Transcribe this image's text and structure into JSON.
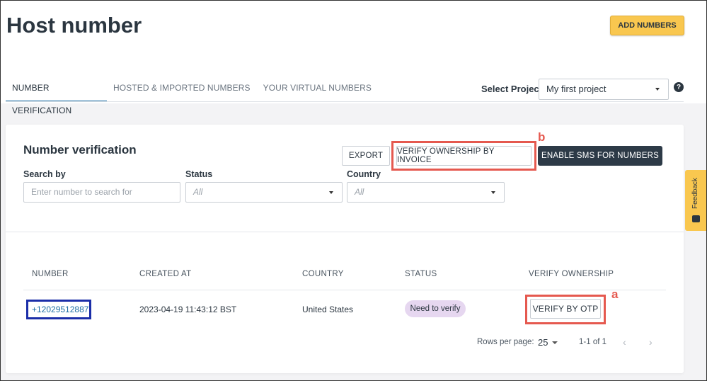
{
  "page": {
    "title": "Host number",
    "add_numbers_label": "ADD NUMBERS"
  },
  "tabs": [
    {
      "label": "NUMBER VERIFICATION",
      "active": true
    },
    {
      "label": "HOSTED & IMPORTED NUMBERS",
      "active": false
    },
    {
      "label": "YOUR VIRTUAL NUMBERS",
      "active": false
    }
  ],
  "project": {
    "label": "Select Project",
    "value": "My first project"
  },
  "card": {
    "title": "Number verification",
    "export_label": "EXPORT",
    "verify_invoice_label": "VERIFY OWNERSHIP BY INVOICE",
    "enable_sms_label": "ENABLE SMS FOR NUMBERS"
  },
  "filters": {
    "search_label": "Search by",
    "search_placeholder": "Enter number to search for",
    "status_label": "Status",
    "status_value": "All",
    "country_label": "Country",
    "country_value": "All"
  },
  "table": {
    "headers": [
      "NUMBER",
      "CREATED AT",
      "COUNTRY",
      "STATUS",
      "VERIFY OWNERSHIP"
    ],
    "rows": [
      {
        "number": "+12029512887",
        "created_at": "2023-04-19 11:43:12 BST",
        "country": "United States",
        "status": "Need to verify",
        "action_label": "VERIFY BY OTP"
      }
    ]
  },
  "pagination": {
    "rows_per_page_label": "Rows per page:",
    "rows_per_page_value": "25",
    "range": "1-1 of 1"
  },
  "annotations": {
    "a": "a",
    "b": "b"
  },
  "feedback_label": "Feedback",
  "colors": {
    "accent_yellow": "#f9c74f",
    "dark_button": "#2d3a47",
    "link_blue": "#1d6fa5",
    "highlight_red": "#e5594f",
    "highlight_blue": "#1b2ea8",
    "badge_purple": "#e6d7f0"
  },
  "icons": {
    "help": "help-icon",
    "caret": "caret-down-icon",
    "prev": "chevron-left-icon",
    "next": "chevron-right-icon",
    "feedback": "feedback-icon"
  }
}
